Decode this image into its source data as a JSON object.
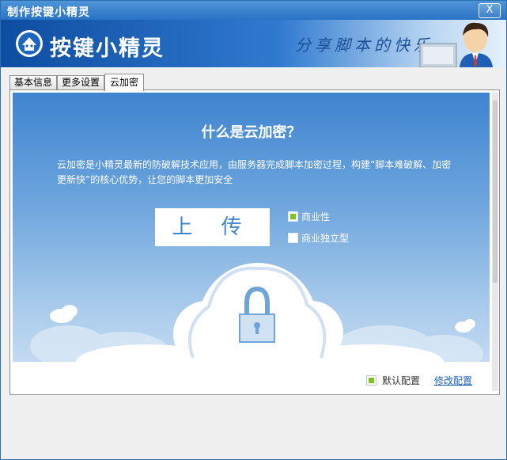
{
  "window": {
    "title": "制作按键小精灵",
    "close_label": "X"
  },
  "banner": {
    "app_name": "按键小精灵",
    "slogan": "分享脚本的快乐",
    "brand_color": "#1a5fb4"
  },
  "tabs": [
    {
      "label": "基本信息",
      "active": false
    },
    {
      "label": "更多设置",
      "active": false
    },
    {
      "label": "云加密",
      "active": true
    }
  ],
  "main": {
    "heading": "什么是云加密？",
    "description": "云加密是小精灵最新的防破解技术应用，由服务器完成脚本加密过程，构建“脚本难破解、加密更新快”的核心优势，让您的脚本更加安全",
    "upload_label": "上 传",
    "options": [
      {
        "label": "商业性",
        "checked": true
      },
      {
        "label": "商业独立型",
        "checked": false
      }
    ],
    "footer": {
      "default_config_label": "默认配置",
      "default_config_checked": true,
      "modify_link": "修改配置"
    }
  },
  "colors": {
    "accent_green": "#7ec421",
    "panel_blue": "#3f84cf"
  }
}
